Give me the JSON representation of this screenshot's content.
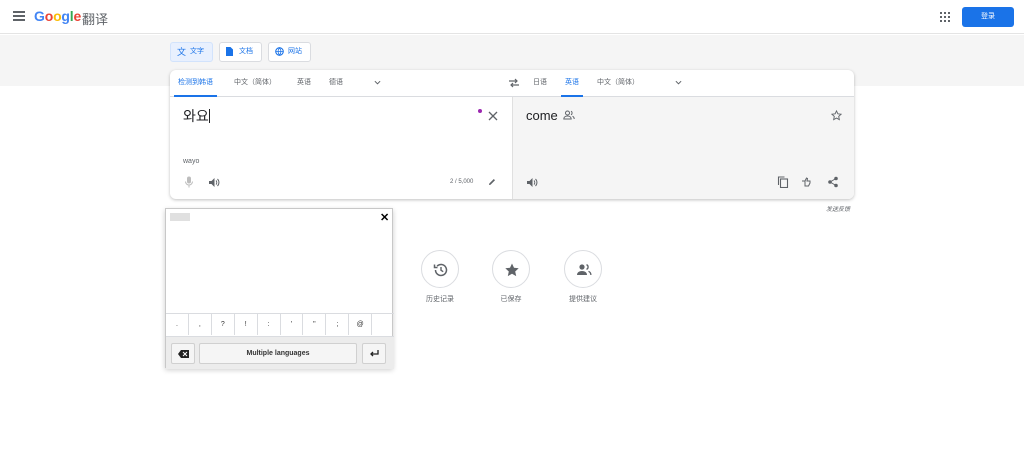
{
  "header": {
    "logo": "Google",
    "product": "翻译",
    "signin_label": "登录",
    "apps_icon": "apps-grid-icon",
    "menu_icon": "hamburger-menu-icon"
  },
  "modes": [
    {
      "label": "文字",
      "icon": "translate-icon",
      "active": true
    },
    {
      "label": "文档",
      "icon": "document-icon",
      "active": false
    },
    {
      "label": "网站",
      "icon": "globe-icon",
      "active": false
    }
  ],
  "source_langs": [
    "检测到韩语",
    "中文（简体）",
    "英语",
    "德语"
  ],
  "target_langs": [
    "日语",
    "英语",
    "中文（简体）"
  ],
  "source": {
    "text": "와요",
    "transliteration": "wayo",
    "counter": "2 / 5,000"
  },
  "target": {
    "text": "come"
  },
  "feedback_label": "发送反馈",
  "keyboard": {
    "keys": [
      ".",
      ",",
      "?",
      "!",
      ":",
      "'",
      "\"",
      ";",
      "@",
      ""
    ],
    "language_button": "Multiple languages"
  },
  "shortcuts": [
    {
      "label": "历史记录",
      "icon": "history-icon"
    },
    {
      "label": "已保存",
      "icon": "star-icon"
    },
    {
      "label": "提供建议",
      "icon": "community-icon"
    }
  ],
  "colors": {
    "accent": "#1a73e8",
    "dot": "#9c27b0"
  }
}
